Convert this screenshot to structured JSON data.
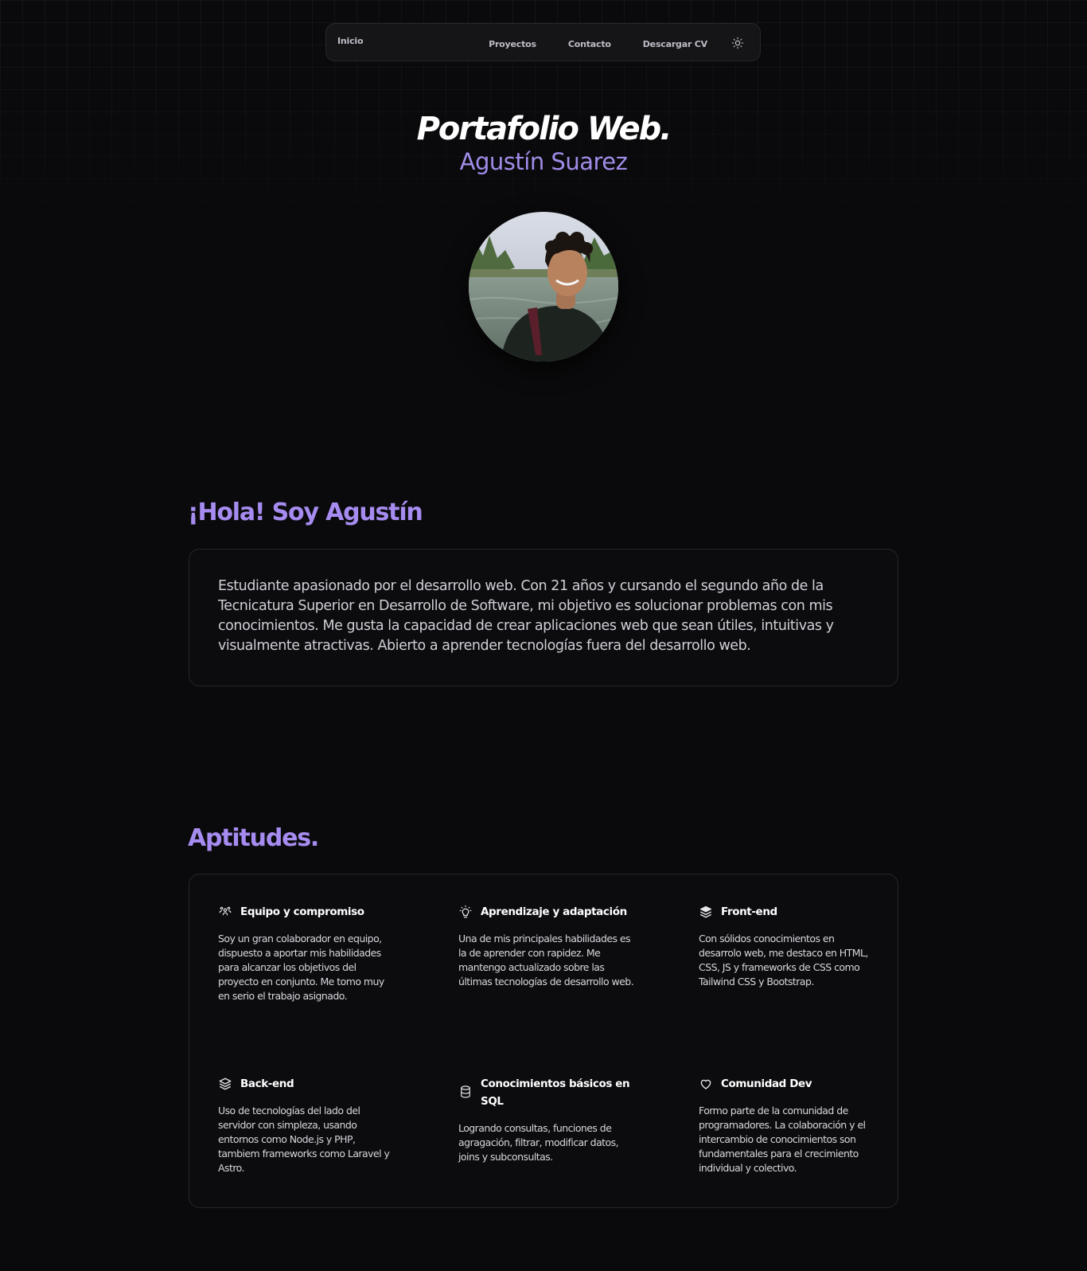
{
  "nav": {
    "home": "Inicio",
    "links": [
      "Proyectos",
      "Contacto",
      "Descargar CV"
    ],
    "theme_icon": "sun-icon"
  },
  "hero": {
    "title": "Portafolio Web.",
    "subtitle": "Agustín Suarez"
  },
  "about": {
    "heading": "¡Hola! Soy Agustín",
    "text": "Estudiante apasionado por el desarrollo web. Con 21 años y cursando el segundo año de la Tecnicatura Superior en Desarrollo de Software, mi objetivo es solucionar problemas con mis conocimientos. Me gusta la capacidad de crear aplicaciones web que sean útiles, intuitivas y visualmente atractivas. Abierto a aprender tecnologías fuera del desarrollo web."
  },
  "skills": {
    "heading": "Aptitudes.",
    "items": [
      {
        "icon": "team-icon",
        "title": "Equipo y compromiso",
        "desc": "Soy un gran colaborador en equipo, dispuesto a aportar mis habilidades para alcanzar los objetivos del proyecto en conjunto. Me tomo muy en serio el trabajo asignado."
      },
      {
        "icon": "lightbulb-icon",
        "title": "Aprendizaje y adaptación",
        "desc": "Una de mis principales habilidades es la de aprender con rapidez. Me mantengo actualizado sobre las últimas tecnologías de desarrollo web."
      },
      {
        "icon": "layers-icon",
        "title": "Front-end",
        "desc": "Con sólidos conocimientos en desarrolo web, me destaco en HTML, CSS, JS y frameworks de CSS como Tailwind CSS y Bootstrap."
      },
      {
        "icon": "stack-icon",
        "title": "Back-end",
        "desc": "Uso de tecnologías del lado del servidor con simpleza, usando entornos como Node.js y PHP, tambiem frameworks como Laravel y Astro."
      },
      {
        "icon": "database-icon",
        "title": "Conocimientos básicos en SQL",
        "desc": "Logrando consultas, funciones de agragación, filtrar, modificar datos, joins y subconsultas."
      },
      {
        "icon": "heart-icon",
        "title": "Comunidad Dev",
        "desc": "Formo parte de la comunidad de programadores. La colaboración y el intercambio de conocimientos son fundamentales para el crecimiento individual y colectivo."
      }
    ]
  },
  "colors": {
    "background": "#0a0a0c",
    "accent": "#a68cf0",
    "border": "#26262b"
  }
}
